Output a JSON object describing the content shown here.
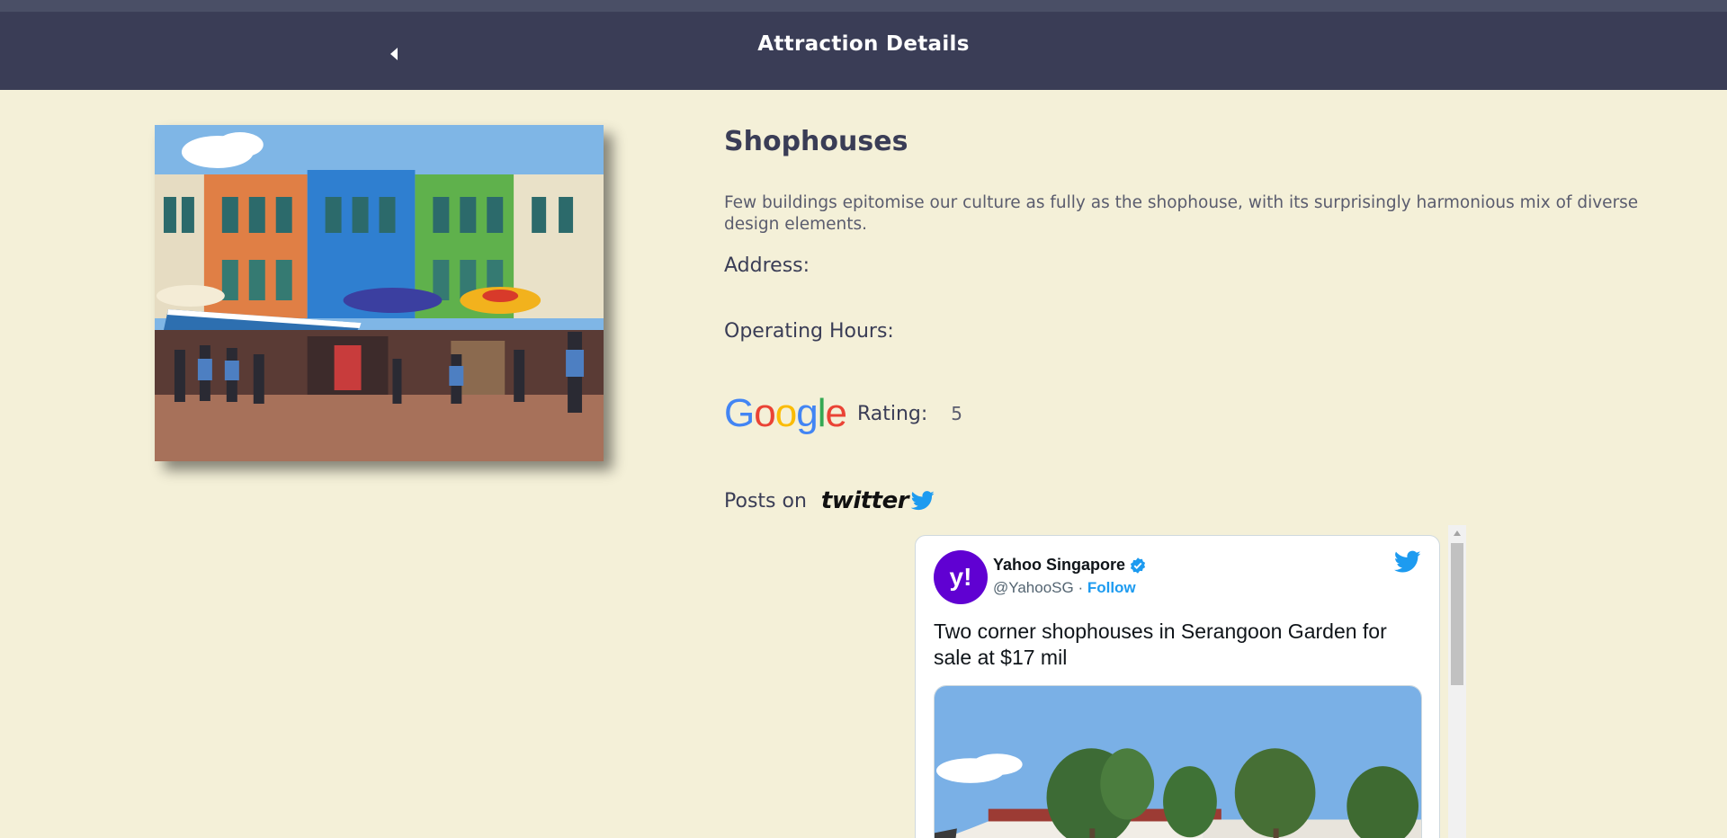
{
  "header": {
    "title": "Attraction Details",
    "back_icon": "caret-left-icon"
  },
  "attraction": {
    "name": "Shophouses",
    "description": "Few buildings epitomise our culture as fully as the shophouse, with its surprisingly harmonious mix of diverse design elements.",
    "address_label": "Address:",
    "hours_label": "Operating Hours:"
  },
  "rating": {
    "google_letters": [
      "G",
      "o",
      "o",
      "g",
      "l",
      "e"
    ],
    "label": "Rating:",
    "value": "5"
  },
  "posts": {
    "label": "Posts on",
    "brand": "twitter"
  },
  "tweet": {
    "account_name": "Yahoo Singapore",
    "avatar_text": "y!",
    "handle": "@YahooSG",
    "separator": " · ",
    "follow_label": "Follow",
    "text": "Two corner shophouses in Serangoon Garden for sale at $17 mil"
  },
  "colors": {
    "header_bg": "#3a3d56",
    "page_bg": "#f4f0d8",
    "avatar_bg": "#6001d2",
    "twitter_blue": "#1d9bf0"
  }
}
